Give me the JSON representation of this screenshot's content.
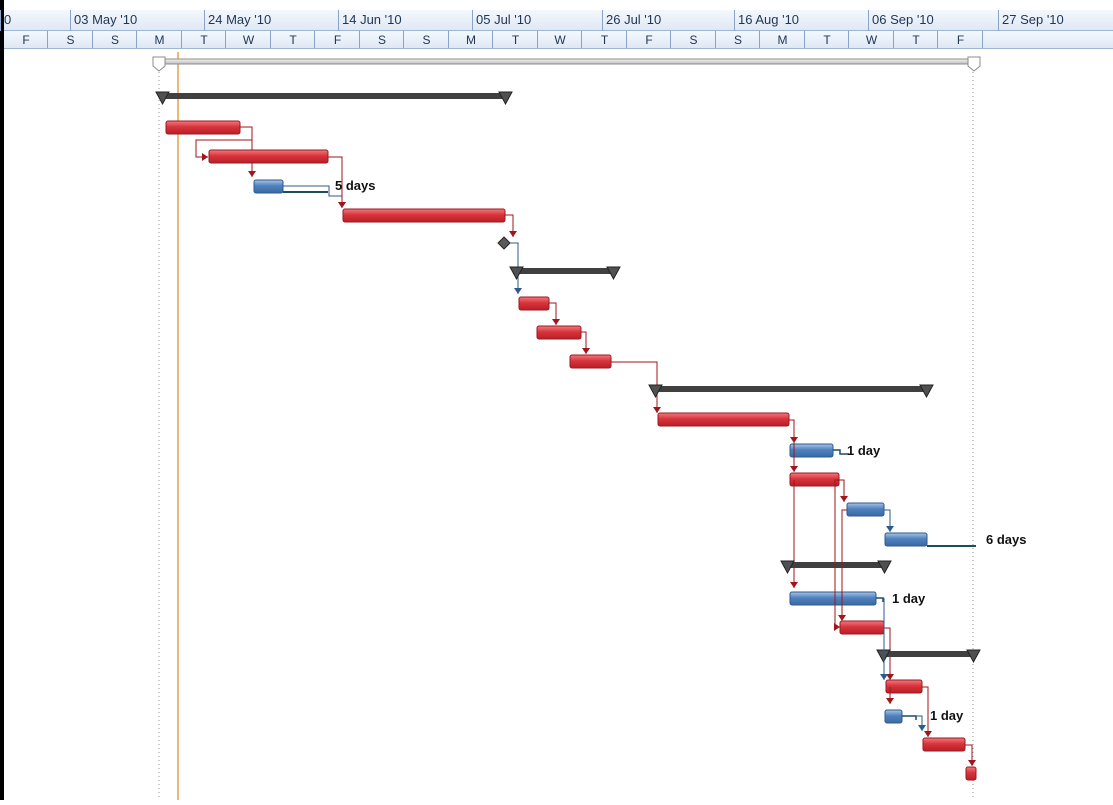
{
  "timescale": {
    "major": [
      "0",
      "03 May '10",
      "24 May '10",
      "14 Jun '10",
      "05 Jul '10",
      "26 Jul '10",
      "16 Aug '10",
      "06 Sep '10",
      "27 Sep '10"
    ],
    "minor": [
      "F",
      "S",
      "S",
      "M",
      "T",
      "W",
      "T",
      "F",
      "S",
      "S",
      "M",
      "T",
      "W",
      "T",
      "F",
      "S",
      "S",
      "M",
      "T",
      "W",
      "T",
      "F"
    ]
  },
  "labels": {
    "label_1": "5 days",
    "label_2": "1 day",
    "label_3": "6 days",
    "label_4": "1 day",
    "label_5": "1 day"
  },
  "colors": {
    "critical": "#d9343c",
    "normal": "#4f81bd",
    "summary": "#404040",
    "today": "#e8a24a",
    "link_critical": "#a0161c",
    "link_normal": "#2b5c8a"
  }
}
